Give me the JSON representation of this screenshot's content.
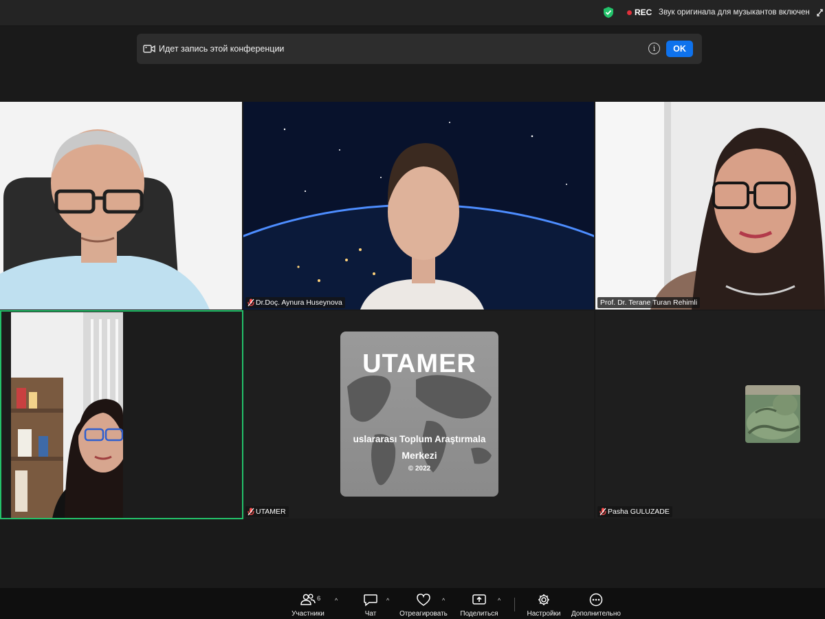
{
  "topbar": {
    "rec_label": "REC",
    "original_sound_label": "Звук оригинала для музыкантов включен",
    "colors": {
      "shield": "#23c26a",
      "rec_dot": "#e0303a"
    }
  },
  "banner": {
    "text": "Идет запись этой конференции",
    "info_glyph": "i",
    "ok_label": "OK",
    "ok_color": "#0e72ed"
  },
  "participants": [
    {
      "name": "",
      "muted": false,
      "active": false
    },
    {
      "name": "Dr.Doç. Aynura Huseynova",
      "muted": true,
      "active": false
    },
    {
      "name": "Prof. Dr. Terane Turan Rehimli",
      "muted": true,
      "active": false
    },
    {
      "name": "",
      "muted": false,
      "active": true
    },
    {
      "name": "UTAMER",
      "muted": true,
      "active": false
    },
    {
      "name": "Pasha GULUZADE",
      "muted": true,
      "active": false
    }
  ],
  "utamer_logo": {
    "brand": "UTAMER",
    "line1": "uslararası Toplum Araştırmala",
    "line2": "Merkezi",
    "copyright": "© 2022"
  },
  "toolbar": {
    "participants": {
      "label": "Участники",
      "count": "6"
    },
    "chat": {
      "label": "Чат"
    },
    "react": {
      "label": "Отреагировать"
    },
    "share": {
      "label": "Поделиться"
    },
    "settings": {
      "label": "Настройки"
    },
    "more": {
      "label": "Дополнительно"
    }
  },
  "icons": {
    "shield": "shield-check-icon",
    "camera": "video-camera-icon",
    "info": "info-icon",
    "mic_muted": "mic-muted-icon",
    "participants": "people-icon",
    "chat": "chat-bubble-icon",
    "react": "heart-icon",
    "share": "share-screen-icon",
    "settings": "gear-icon",
    "more": "more-dots-icon"
  }
}
